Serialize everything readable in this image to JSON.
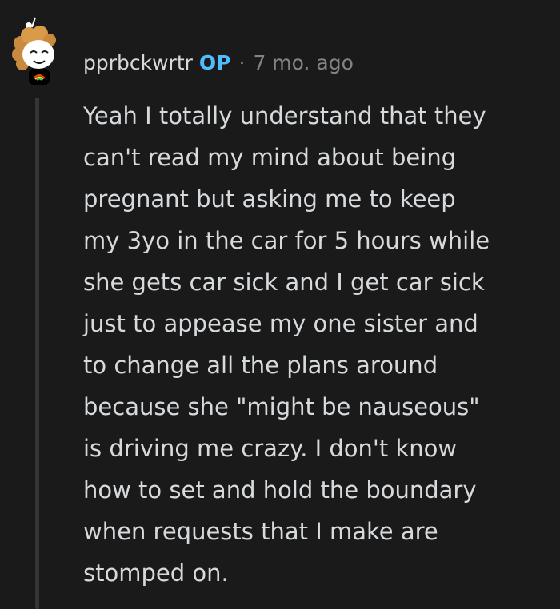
{
  "comment": {
    "author": "pprbckwrtr",
    "badge": "OP",
    "separator": "·",
    "timestamp": "7 mo. ago",
    "body_lines": [
      "Yeah I totally understand that they",
      "can't read my mind about being",
      "pregnant but asking me to keep",
      "my 3yo in the car for 5 hours while",
      "she gets car sick and I get car sick",
      "just to appease my one sister and",
      "to change all the plans around",
      "because she \"might be nauseous\"",
      "is driving me crazy. I don't know",
      "how to set and hold the boundary",
      "when requests that I make are",
      "stomped on."
    ]
  },
  "colors": {
    "background": "#1a1a1b",
    "text": "#d7dadc",
    "op_badge": "#4fbcff",
    "meta": "#818384",
    "thread_line": "#343536"
  },
  "icons": {
    "avatar": "snoo-avatar-curly-hair-icon"
  }
}
